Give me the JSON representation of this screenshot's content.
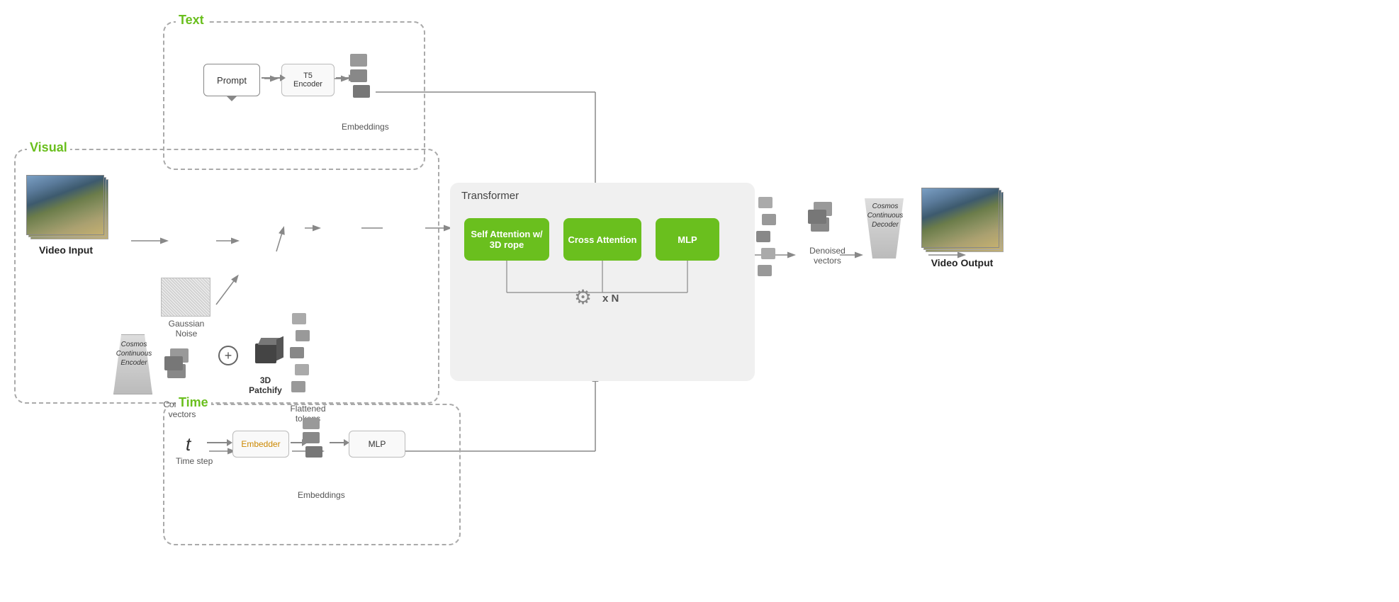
{
  "sections": {
    "text": {
      "label": "Text",
      "prompt": "Prompt",
      "encoder": "T5\nEncoder",
      "embeddings": "Embeddings"
    },
    "visual": {
      "label": "Visual",
      "cosmos_encoder": "Cosmos\nContinuous\nEncoder",
      "corrupted_vectors": "Corrupted\nvectors",
      "gaussian_noise": "Gaussian Noise",
      "patchify": "3D\nPatchify",
      "flattened_tokens": "Flattened\ntokens",
      "video_input": "Video Input"
    },
    "transformer": {
      "label": "Transformer",
      "self_attn": "Self Attention w/ 3D rope",
      "cross_attn": "Cross Attention",
      "mlp": "MLP",
      "xn": "x N"
    },
    "time": {
      "label": "Time",
      "timestep": "t",
      "timestep_label": "Time step",
      "embedder": "Embedder",
      "mlp": "MLP",
      "embeddings": "Embeddings"
    },
    "output": {
      "denoised_vectors": "Denoised\nvectors",
      "cosmos_decoder": "Cosmos\nContinuous\nDecoder",
      "video_output": "Video Output"
    }
  }
}
